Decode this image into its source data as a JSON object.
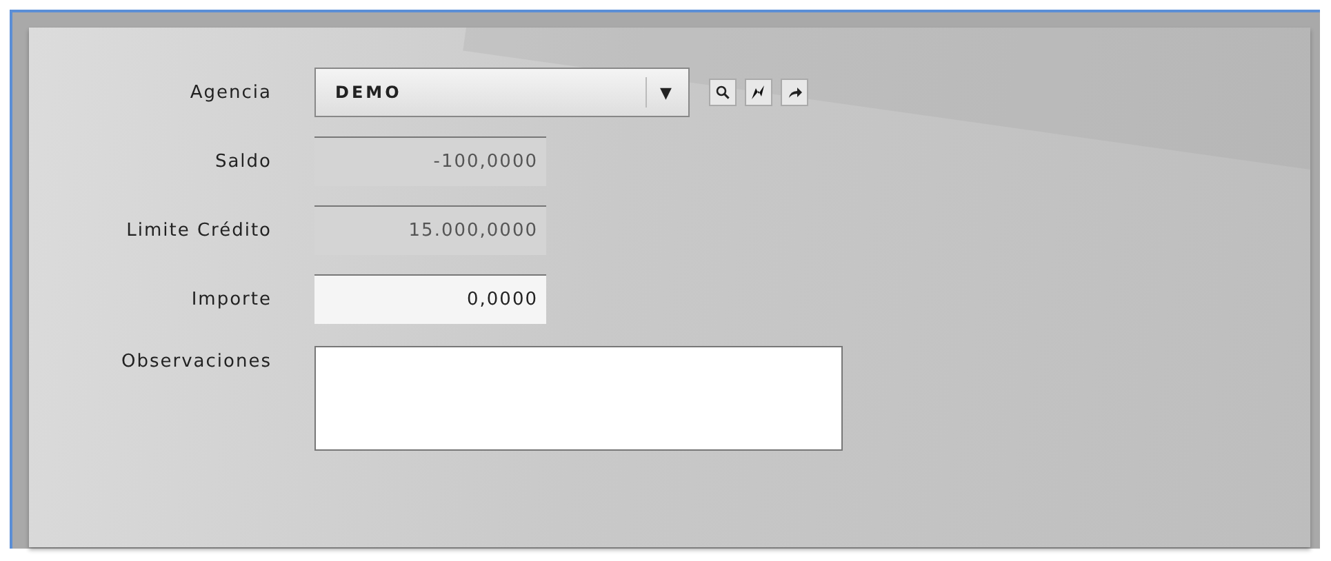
{
  "form": {
    "fields": [
      {
        "kind": "dropdown",
        "label": "Agencia",
        "value": "DEMO",
        "arrow": "▼"
      },
      {
        "kind": "number",
        "label": "Saldo",
        "value": "-100,0000",
        "readonly": true
      },
      {
        "kind": "number",
        "label": "Limite Crédito",
        "value": "15.000,0000",
        "readonly": true
      },
      {
        "kind": "number",
        "label": "Importe",
        "value": "0,0000",
        "readonly": false
      },
      {
        "kind": "textarea",
        "label": "Observaciones"
      }
    ]
  }
}
